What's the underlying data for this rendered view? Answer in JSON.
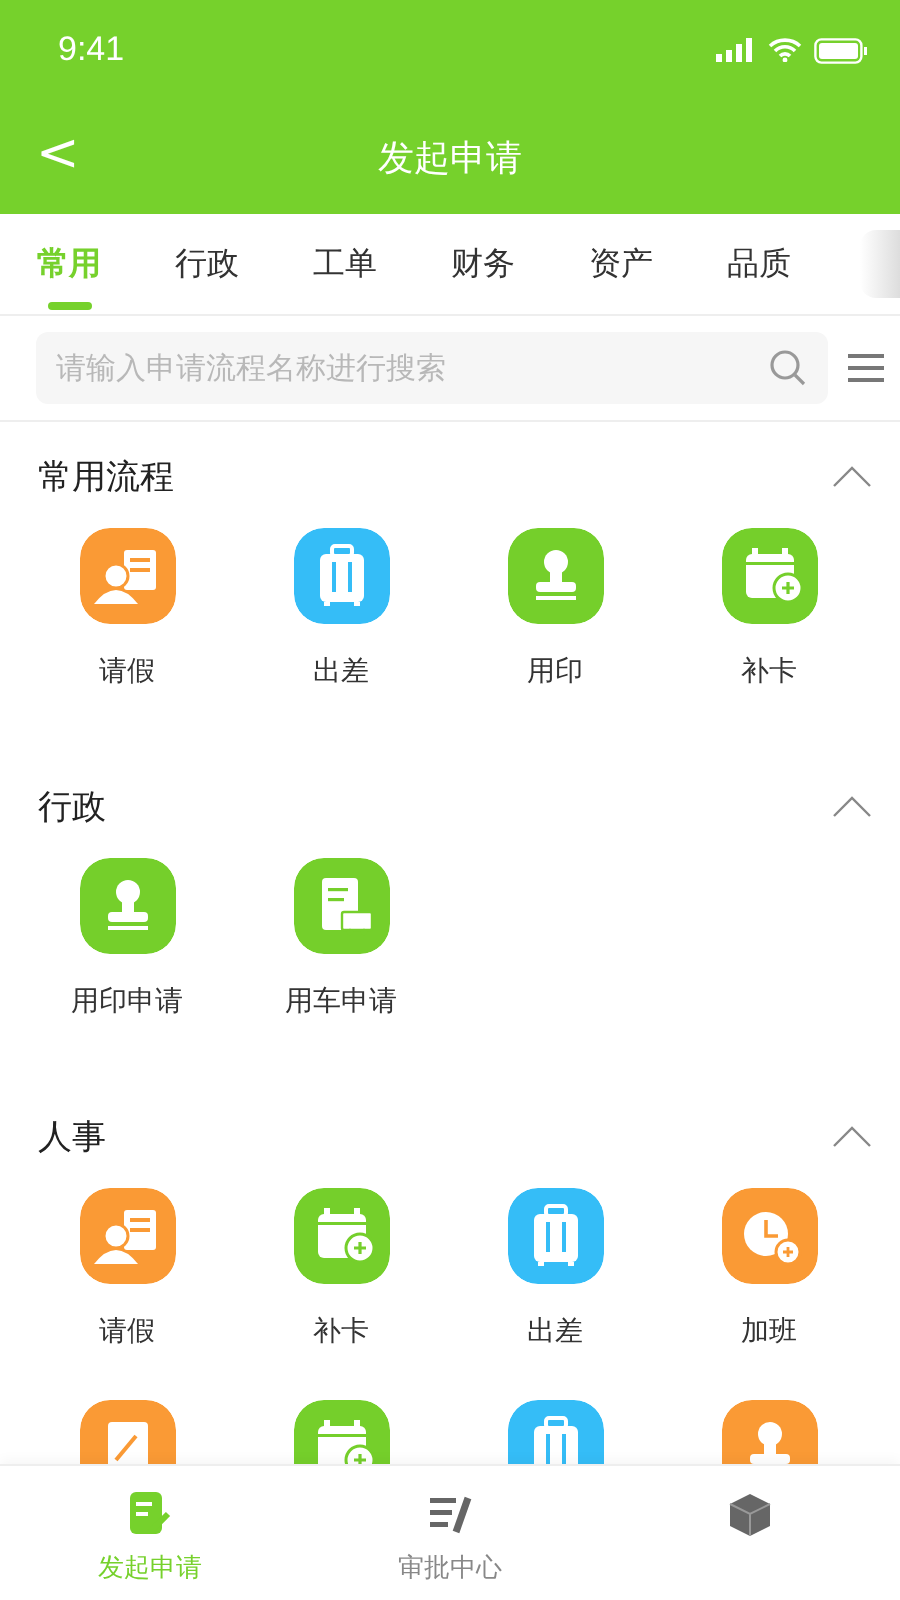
{
  "status_bar": {
    "time": "9:41"
  },
  "nav": {
    "title": "发起申请",
    "back": "<"
  },
  "tabs": [
    {
      "label": "常用",
      "selected": true
    },
    {
      "label": "行政",
      "selected": false
    },
    {
      "label": "工单",
      "selected": false
    },
    {
      "label": "财务",
      "selected": false
    },
    {
      "label": "资产",
      "selected": false
    },
    {
      "label": "品质",
      "selected": false
    }
  ],
  "search": {
    "placeholder": "请输入申请流程名称进行搜索"
  },
  "sections": [
    {
      "title": "常用流程",
      "expanded": true,
      "items": [
        {
          "label": "请假",
          "kind": "leave"
        },
        {
          "label": "出差",
          "kind": "trip"
        },
        {
          "label": "用印",
          "kind": "seal"
        },
        {
          "label": "补卡",
          "kind": "card"
        }
      ]
    },
    {
      "title": "行政",
      "expanded": true,
      "items": [
        {
          "label": "用印申请",
          "kind": "seal"
        },
        {
          "label": "用车申请",
          "kind": "car"
        }
      ]
    },
    {
      "title": "人事",
      "expanded": true,
      "items": [
        {
          "label": "请假",
          "kind": "leave"
        },
        {
          "label": "补卡",
          "kind": "card"
        },
        {
          "label": "出差",
          "kind": "trip"
        },
        {
          "label": "加班",
          "kind": "overtime"
        },
        {
          "kind": "doc"
        },
        {
          "kind": "card"
        },
        {
          "kind": "trip"
        },
        {
          "kind": "seal-orange"
        }
      ]
    }
  ],
  "bottom_tabs": [
    {
      "label": "发起申请",
      "kind": "apply",
      "selected": true
    },
    {
      "label": "审批中心",
      "kind": "approve",
      "selected": false
    },
    {
      "kind": "box",
      "selected": false
    }
  ]
}
